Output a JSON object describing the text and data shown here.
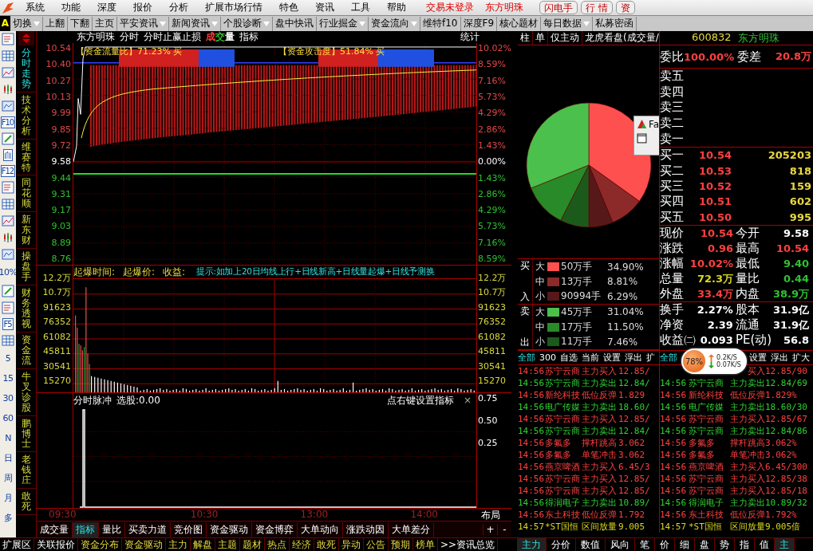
{
  "menu_bar": {
    "items": [
      "系统",
      "功能",
      "深度",
      "报价",
      "分析",
      "扩展市场行情",
      "特色",
      "资讯",
      "工具",
      "帮助"
    ],
    "login_status": "交易未登录",
    "stock": "东方明珠",
    "buttons": [
      "闪电手",
      "行 情",
      "资"
    ]
  },
  "toolbar": {
    "badge": "A",
    "items": [
      {
        "label": "切换",
        "dropdown": true
      },
      {
        "label": "上翻",
        "dropdown": false
      },
      {
        "label": "下翻",
        "dropdown": false
      },
      {
        "label": "主页",
        "dropdown": false
      },
      {
        "label": "平安资讯",
        "dropdown": true
      },
      {
        "label": "新闻资讯",
        "dropdown": true
      },
      {
        "label": "个股诊断",
        "dropdown": true
      },
      {
        "label": "盘中快讯",
        "dropdown": false
      },
      {
        "label": "行业掘金",
        "dropdown": true
      },
      {
        "label": "资金流向",
        "dropdown": true
      },
      {
        "label": "维特f10",
        "dropdown": false
      },
      {
        "label": "深度F9",
        "dropdown": false
      },
      {
        "label": "核心题材",
        "dropdown": false
      },
      {
        "label": "每日数据",
        "dropdown": true
      },
      {
        "label": "私募密函",
        "dropdown": false
      }
    ]
  },
  "tool_column": [
    {
      "kind": "icon"
    },
    {
      "kind": "icon"
    },
    {
      "kind": "icon"
    },
    {
      "kind": "icon"
    },
    {
      "kind": "icon"
    },
    {
      "kind": "label",
      "label": "F10"
    },
    {
      "kind": "icon"
    },
    {
      "kind": "label",
      "label": "自"
    },
    {
      "kind": "label",
      "label": "F12"
    },
    {
      "kind": "icon"
    },
    {
      "kind": "icon"
    },
    {
      "kind": "icon"
    },
    {
      "kind": "icon"
    },
    {
      "kind": "icon"
    },
    {
      "kind": "text",
      "label": "10%"
    },
    {
      "kind": "icon"
    },
    {
      "kind": "icon"
    },
    {
      "kind": "label",
      "label": "F5"
    },
    {
      "kind": "icon"
    },
    {
      "kind": "text",
      "label": "5"
    },
    {
      "kind": "text",
      "label": "15"
    },
    {
      "kind": "text",
      "label": "30"
    },
    {
      "kind": "text",
      "label": "60"
    },
    {
      "kind": "text",
      "label": "N"
    },
    {
      "kind": "text",
      "label": "日"
    },
    {
      "kind": "text",
      "label": "周"
    },
    {
      "kind": "text",
      "label": "月"
    },
    {
      "kind": "text",
      "label": "多"
    }
  ],
  "view_tabs": [
    {
      "label": "分时走势",
      "selected": true
    },
    {
      "label": "技术分析",
      "selected": false
    },
    {
      "label": "维赛特",
      "selected": false
    },
    {
      "label": "同花顺",
      "selected": false
    },
    {
      "label": "新东财",
      "selected": false
    },
    {
      "label": "操盘手",
      "selected": false
    },
    {
      "label": "财务透视",
      "selected": false
    },
    {
      "label": "资金流",
      "selected": false
    },
    {
      "label": "牛叉诊股",
      "selected": false
    },
    {
      "label": "鹏博士",
      "selected": false
    },
    {
      "label": "老钱庄",
      "selected": false
    },
    {
      "label": "敢死",
      "selected": false
    }
  ],
  "chart_header": {
    "stock": "东方明珠",
    "items": [
      "分时",
      "分时止赢止损"
    ],
    "volume_label": [
      {
        "text": "成",
        "color": "#ff3c3c"
      },
      {
        "text": "交",
        "color": "#30c030"
      },
      {
        "text": "量",
        "color": "#ffffff"
      }
    ],
    "indicator": "指标",
    "stats": "统计"
  },
  "price_panel": {
    "overlays": [
      "【资金流量比】71.23% 买",
      "【资金攻击度】51.84% 买"
    ],
    "left_ticks": [
      {
        "label": "10.54",
        "kind": "up"
      },
      {
        "label": "10.40",
        "kind": "up"
      },
      {
        "label": "10.27",
        "kind": "up"
      },
      {
        "label": "10.13",
        "kind": "up"
      },
      {
        "label": "9.99",
        "kind": "up"
      },
      {
        "label": "9.85",
        "kind": "up"
      },
      {
        "label": "9.72",
        "kind": "up"
      },
      {
        "label": "9.58",
        "kind": "flat"
      },
      {
        "label": "9.44",
        "kind": "down"
      },
      {
        "label": "9.31",
        "kind": "down"
      },
      {
        "label": "9.17",
        "kind": "down"
      },
      {
        "label": "9.03",
        "kind": "down"
      },
      {
        "label": "8.89",
        "kind": "down"
      },
      {
        "label": "8.76",
        "kind": "down"
      }
    ],
    "right_ticks": [
      {
        "label": "10.02%",
        "kind": "up"
      },
      {
        "label": "8.59%",
        "kind": "up"
      },
      {
        "label": "7.16%",
        "kind": "up"
      },
      {
        "label": "5.73%",
        "kind": "up"
      },
      {
        "label": "4.29%",
        "kind": "up"
      },
      {
        "label": "2.86%",
        "kind": "up"
      },
      {
        "label": "1.43%",
        "kind": "up"
      },
      {
        "label": "0.00%",
        "kind": "flat"
      },
      {
        "label": "1.43%",
        "kind": "down"
      },
      {
        "label": "2.86%",
        "kind": "down"
      },
      {
        "label": "4.29%",
        "kind": "down"
      },
      {
        "label": "5.73%",
        "kind": "down"
      },
      {
        "label": "7.16%",
        "kind": "down"
      },
      {
        "label": "8.59%",
        "kind": "down"
      }
    ]
  },
  "volume_panel": {
    "fields": [
      "起爆时间:",
      "起爆价:",
      "收益:"
    ],
    "hint": "提示:如加上20日均线上行+日线新高+日线量起爆+日线予测换",
    "left_ticks": [
      "12.2万",
      "10.7万",
      "91623",
      "76352",
      "61082",
      "45811",
      "30541",
      "15270"
    ],
    "right_ticks": [
      "12.2万",
      "10.7万",
      "91623",
      "76352",
      "61082",
      "45811",
      "30541",
      "15270"
    ]
  },
  "indicator_panel": {
    "title": "分时脉冲",
    "value": "选股:0.00",
    "hint": "点右键设置指标",
    "close": "×",
    "ticks": [
      "0.75",
      "0.50",
      "0.25"
    ]
  },
  "time_axis": {
    "labels": [
      "09:30",
      "10:30",
      "13:00",
      "14:00"
    ],
    "layout_button": "布局"
  },
  "chart_tabs": {
    "items": [
      {
        "label": "成交量",
        "selected": false
      },
      {
        "label": "指标",
        "selected": true
      },
      {
        "label": "量比",
        "selected": false
      },
      {
        "label": "买卖力道",
        "selected": false
      },
      {
        "label": "竞价图",
        "selected": false
      },
      {
        "label": "资金驱动",
        "selected": false
      },
      {
        "label": "资金博弈",
        "selected": false
      },
      {
        "label": "大单动向",
        "selected": false
      },
      {
        "label": "涨跌动因",
        "selected": false
      },
      {
        "label": "大单差分",
        "selected": false
      }
    ],
    "controls": [
      "+",
      "-"
    ]
  },
  "pie": {
    "tabs": [
      "柱",
      "单",
      "仅主动",
      "龙虎看盘(成交量/"
    ],
    "chart_data": {
      "type": "pie",
      "values": [
        34.9,
        8.81,
        6.29,
        7.46,
        11.5,
        31.04
      ]
    },
    "sides": [
      {
        "top": "买",
        "bottom": "入",
        "rows": [
          {
            "size": "大",
            "amount": "50万手",
            "share": "34.90%",
            "color": "#ff5050"
          },
          {
            "size": "中",
            "amount": "13万手",
            "share": "8.81%",
            "color": "#8c2a2a"
          },
          {
            "size": "小",
            "amount": "90994手",
            "share": "6.29%",
            "color": "#561818"
          }
        ]
      },
      {
        "top": "卖",
        "bottom": "出",
        "rows": [
          {
            "size": "大",
            "amount": "45万手",
            "share": "31.04%",
            "color": "#4cc04c"
          },
          {
            "size": "中",
            "amount": "17万手",
            "share": "11.50%",
            "color": "#288a28"
          },
          {
            "size": "小",
            "amount": "11万手",
            "share": "7.46%",
            "color": "#1c5a1c"
          }
        ]
      }
    ]
  },
  "popup": {
    "title": "Fa"
  },
  "quote": {
    "code": "600832",
    "name": "东方明珠",
    "ratio_label": "委比",
    "ratio": "100.00%",
    "diff_label": "委差",
    "diff": "20.8万",
    "asks": [
      "卖五",
      "卖四",
      "卖三",
      "卖二",
      "卖一"
    ],
    "bids": [
      {
        "label": "买一",
        "price": "10.54",
        "volume": "205203"
      },
      {
        "label": "买二",
        "price": "10.53",
        "volume": "818"
      },
      {
        "label": "买三",
        "price": "10.52",
        "volume": "159"
      },
      {
        "label": "买四",
        "price": "10.51",
        "volume": "602"
      },
      {
        "label": "买五",
        "price": "10.50",
        "volume": "995"
      }
    ],
    "stats": [
      {
        "label": "现价",
        "value": "10.54",
        "color": "#ff4040"
      },
      {
        "label": "今开",
        "value": "9.58",
        "color": "#ffffff"
      },
      {
        "label": "涨跌",
        "value": "0.96",
        "color": "#ff4040"
      },
      {
        "label": "最高",
        "value": "10.54",
        "color": "#ff4040"
      },
      {
        "label": "涨幅",
        "value": "10.02%",
        "color": "#ff4040"
      },
      {
        "label": "最低",
        "value": "9.40",
        "color": "#30c030"
      },
      {
        "label": "总量",
        "value": "72.3万",
        "color": "#d8d820"
      },
      {
        "label": "量比",
        "value": "0.44",
        "color": "#30c030"
      },
      {
        "label": "外盘",
        "value": "33.4万",
        "color": "#ff4040"
      },
      {
        "label": "内盘",
        "value": "38.9万",
        "color": "#30c030"
      }
    ],
    "finance": [
      {
        "label": "换手",
        "value": "2.27%"
      },
      {
        "label": "股本",
        "value": "31.9亿"
      },
      {
        "label": "净资",
        "value": "2.39"
      },
      {
        "label": "流通",
        "value": "31.9亿"
      },
      {
        "label": "收益㈡",
        "value": "0.093"
      },
      {
        "label": "PE(动)",
        "value": "56.8"
      }
    ]
  },
  "news": {
    "left_tabs": [
      {
        "label": "全部",
        "selected": true
      },
      {
        "label": "300",
        "selected": false
      },
      {
        "label": "自选",
        "selected": false
      },
      {
        "label": "当前",
        "selected": false
      },
      {
        "label": "设置",
        "selected": false
      },
      {
        "label": "浮出",
        "selected": false
      },
      {
        "label": "扩",
        "selected": false
      }
    ],
    "right_tabs": [
      {
        "label": "全部",
        "selected": true
      },
      {
        "label": "设置",
        "selected": false
      },
      {
        "label": "浮出",
        "selected": false
      },
      {
        "label": "扩大",
        "selected": false
      }
    ],
    "rows": [
      {
        "time": "14:56",
        "name": "苏宁云商",
        "event": "主力买入",
        "value": "12.85/",
        "right": {
          "event": "买入",
          "value": "12.85/90"
        },
        "color": "#ff4040"
      },
      {
        "time": "14:56",
        "name": "苏宁云商",
        "event": "主力卖出",
        "value": "12.84/",
        "right": {
          "time": "14:56",
          "name": "苏宁云商",
          "event": "主力卖出",
          "value": "12.84/69"
        },
        "color": "#30d030"
      },
      {
        "time": "14:56",
        "name": "新纶科技",
        "event": "低位反弹",
        "value": "1.829",
        "right": {
          "time": "14:56",
          "name": "新纶科技",
          "event": "低位反弹",
          "value": "1.829%"
        },
        "color": "#ff4040"
      },
      {
        "time": "14:56",
        "name": "电广传媒",
        "event": "主力卖出",
        "value": "18.60/",
        "right": {
          "time": "14:56",
          "name": "电广传媒",
          "event": "主力卖出",
          "value": "18.60/30"
        },
        "color": "#30d030"
      },
      {
        "time": "14:56",
        "name": "苏宁云商",
        "event": "主力买入",
        "value": "12.85/",
        "right": {
          "time": "14:56",
          "name": "苏宁云商",
          "event": "主力买入",
          "value": "12.85/67"
        },
        "color": "#ff4040"
      },
      {
        "time": "14:56",
        "name": "苏宁云商",
        "event": "主力卖出",
        "value": "12.84/",
        "right": {
          "time": "14:56",
          "name": "苏宁云商",
          "event": "主力卖出",
          "value": "12.84/86"
        },
        "color": "#30d030"
      },
      {
        "time": "14:56",
        "name": "多氟多",
        "event": "撑杆跳高",
        "value": "3.062",
        "right": {
          "time": "14:56",
          "name": "多氟多",
          "event": "撑杆跳高",
          "value": "3.062%"
        },
        "color": "#ff4040"
      },
      {
        "time": "14:56",
        "name": "多氟多",
        "event": "单笔冲击",
        "value": "3.062",
        "right": {
          "time": "14:56",
          "name": "多氟多",
          "event": "单笔冲击",
          "value": "3.062%"
        },
        "color": "#ff4040"
      },
      {
        "time": "14:56",
        "name": "燕京啤酒",
        "event": "主力买入",
        "value": "6.45/3",
        "right": {
          "time": "14:56",
          "name": "燕京啤酒",
          "event": "主力买入",
          "value": "6.45/300"
        },
        "color": "#ff4040"
      },
      {
        "time": "14:56",
        "name": "苏宁云商",
        "event": "主力买入",
        "value": "12.85/",
        "right": {
          "time": "14:56",
          "name": "苏宁云商",
          "event": "主力买入",
          "value": "12.85/38"
        },
        "color": "#ff4040"
      },
      {
        "time": "14:56",
        "name": "苏宁云商",
        "event": "主力买入",
        "value": "12.85/",
        "right": {
          "time": "14:56",
          "name": "苏宁云商",
          "event": "主力买入",
          "value": "12.85/18"
        },
        "color": "#ff4040"
      },
      {
        "time": "14:56",
        "name": "得润电子",
        "event": "主力卖出",
        "value": "10.89/",
        "right": {
          "time": "14:56",
          "name": "得润电子",
          "event": "主力卖出",
          "value": "10.89/32"
        },
        "color": "#30d030"
      },
      {
        "time": "14:56",
        "name": "东土科技",
        "event": "低位反弹",
        "value": "1.792",
        "right": {
          "time": "14:56",
          "name": "东土科技",
          "event": "低位反弹",
          "value": "1.792%"
        },
        "color": "#ff4040"
      },
      {
        "time": "14:57",
        "name": "*ST国恒",
        "event": "区间放量",
        "value": "9.005",
        "right": {
          "time": "14:57",
          "name": "*ST国恒",
          "event": "区间放量",
          "value": "9.005倍"
        },
        "color": "#d8d820"
      }
    ]
  },
  "speed_widget": {
    "percent": "78%",
    "up": "0.2K/S",
    "down": "0.07K/S"
  },
  "bottom_bar": {
    "left": [
      {
        "label": "扩展区",
        "kind": "title"
      },
      {
        "label": "关联报价",
        "kind": "title"
      },
      {
        "label": "资金分布",
        "kind": "link"
      },
      {
        "label": "资金驱动",
        "kind": "link"
      },
      {
        "label": "主力",
        "kind": "link"
      },
      {
        "label": "解盘",
        "kind": "link"
      },
      {
        "label": "主题",
        "kind": "link"
      },
      {
        "label": "题材",
        "kind": "link"
      },
      {
        "label": "热点",
        "kind": "link"
      },
      {
        "label": "经济",
        "kind": "link"
      },
      {
        "label": "敢死",
        "kind": "link"
      },
      {
        "label": "异动",
        "kind": "link"
      },
      {
        "label": "公告",
        "kind": "link"
      },
      {
        "label": "预期",
        "kind": "link"
      },
      {
        "label": "榜单",
        "kind": "link"
      },
      {
        "label": ">>资讯总览",
        "kind": "title"
      }
    ],
    "right": [
      {
        "label": "主力",
        "selected": true
      },
      {
        "label": "分价",
        "selected": false
      },
      {
        "label": "数值",
        "selected": false
      },
      {
        "label": "风向",
        "selected": false
      },
      {
        "label": "笔",
        "selected": false
      },
      {
        "label": "价",
        "selected": false
      },
      {
        "label": "细",
        "selected": false
      },
      {
        "label": "盘",
        "selected": false
      },
      {
        "label": "势",
        "selected": false
      },
      {
        "label": "指",
        "selected": false
      },
      {
        "label": "值",
        "selected": false
      },
      {
        "label": "主",
        "selected": true
      }
    ]
  }
}
